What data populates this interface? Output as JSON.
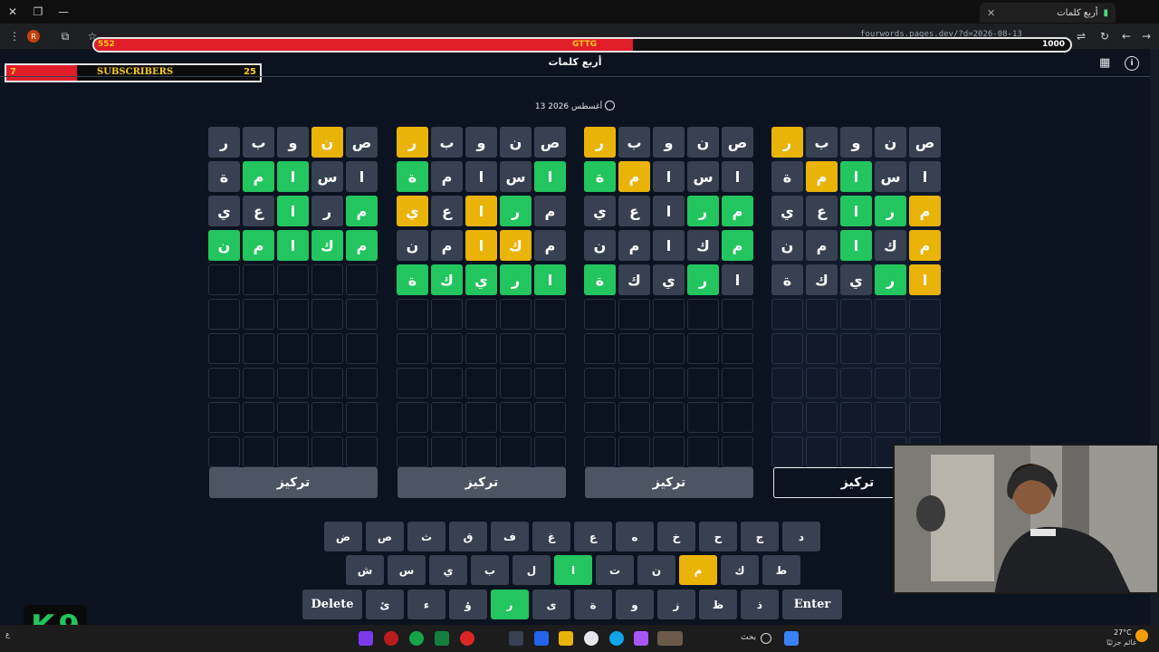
{
  "browser": {
    "tab_title": "أربع كلمات",
    "url": "fourwords.pages.dev/?d=2026-08-13",
    "profile_initial": "R"
  },
  "overlay": {
    "hp_left": "552",
    "hp_center": "GTTG",
    "hp_right": "1000",
    "hp_fill_fraction": 0.552,
    "subs_count_left": "7",
    "subs_label": "SUBSCRIBERS",
    "subs_goal": "25",
    "subs_fill_fraction": 0.28,
    "logo_letters": [
      "K",
      "9"
    ]
  },
  "app": {
    "title": "أربع كلمات",
    "date": "13 أغسطس 2026",
    "focus_label": "تركيز"
  },
  "boards": [
    {
      "id": "board-1",
      "focused": true,
      "rows": [
        [
          [
            "ص",
            "b"
          ],
          [
            "ن",
            "b"
          ],
          [
            "و",
            "b"
          ],
          [
            "ب",
            "b"
          ],
          [
            "ر",
            "y"
          ]
        ],
        [
          [
            "ا",
            "b"
          ],
          [
            "س",
            "b"
          ],
          [
            "ا",
            "g"
          ],
          [
            "م",
            "y"
          ],
          [
            "ة",
            "b"
          ]
        ],
        [
          [
            "م",
            "y"
          ],
          [
            "ر",
            "g"
          ],
          [
            "ا",
            "g"
          ],
          [
            "ع",
            "b"
          ],
          [
            "ي",
            "b"
          ]
        ],
        [
          [
            "م",
            "y"
          ],
          [
            "ك",
            "b"
          ],
          [
            "ا",
            "g"
          ],
          [
            "م",
            "b"
          ],
          [
            "ن",
            "b"
          ]
        ],
        [
          [
            "ا",
            "y"
          ],
          [
            "ر",
            "g"
          ],
          [
            "ي",
            "b"
          ],
          [
            "ك",
            "b"
          ],
          [
            "ة",
            "b"
          ]
        ]
      ]
    },
    {
      "id": "board-2",
      "focused": false,
      "rows": [
        [
          [
            "ص",
            "b"
          ],
          [
            "ن",
            "b"
          ],
          [
            "و",
            "b"
          ],
          [
            "ب",
            "b"
          ],
          [
            "ر",
            "y"
          ]
        ],
        [
          [
            "ا",
            "b"
          ],
          [
            "س",
            "b"
          ],
          [
            "ا",
            "b"
          ],
          [
            "م",
            "y"
          ],
          [
            "ة",
            "g"
          ]
        ],
        [
          [
            "م",
            "g"
          ],
          [
            "ر",
            "g"
          ],
          [
            "ا",
            "b"
          ],
          [
            "ع",
            "b"
          ],
          [
            "ي",
            "b"
          ]
        ],
        [
          [
            "م",
            "g"
          ],
          [
            "ك",
            "b"
          ],
          [
            "ا",
            "b"
          ],
          [
            "م",
            "b"
          ],
          [
            "ن",
            "b"
          ]
        ],
        [
          [
            "ا",
            "b"
          ],
          [
            "ر",
            "g"
          ],
          [
            "ي",
            "b"
          ],
          [
            "ك",
            "b"
          ],
          [
            "ة",
            "g"
          ]
        ]
      ]
    },
    {
      "id": "board-3",
      "focused": false,
      "rows": [
        [
          [
            "ص",
            "b"
          ],
          [
            "ن",
            "b"
          ],
          [
            "و",
            "b"
          ],
          [
            "ب",
            "b"
          ],
          [
            "ر",
            "y"
          ]
        ],
        [
          [
            "ا",
            "g"
          ],
          [
            "س",
            "b"
          ],
          [
            "ا",
            "b"
          ],
          [
            "م",
            "b"
          ],
          [
            "ة",
            "g"
          ]
        ],
        [
          [
            "م",
            "b"
          ],
          [
            "ر",
            "g"
          ],
          [
            "ا",
            "y"
          ],
          [
            "ع",
            "b"
          ],
          [
            "ي",
            "y"
          ]
        ],
        [
          [
            "م",
            "b"
          ],
          [
            "ك",
            "y"
          ],
          [
            "ا",
            "y"
          ],
          [
            "م",
            "b"
          ],
          [
            "ن",
            "b"
          ]
        ],
        [
          [
            "ا",
            "g"
          ],
          [
            "ر",
            "g"
          ],
          [
            "ي",
            "g"
          ],
          [
            "ك",
            "g"
          ],
          [
            "ة",
            "g"
          ]
        ]
      ]
    },
    {
      "id": "board-4",
      "focused": false,
      "rows": [
        [
          [
            "ص",
            "b"
          ],
          [
            "ن",
            "y"
          ],
          [
            "و",
            "b"
          ],
          [
            "ب",
            "b"
          ],
          [
            "ر",
            "b"
          ]
        ],
        [
          [
            "ا",
            "b"
          ],
          [
            "س",
            "b"
          ],
          [
            "ا",
            "g"
          ],
          [
            "م",
            "g"
          ],
          [
            "ة",
            "b"
          ]
        ],
        [
          [
            "م",
            "g"
          ],
          [
            "ر",
            "b"
          ],
          [
            "ا",
            "g"
          ],
          [
            "ع",
            "b"
          ],
          [
            "ي",
            "b"
          ]
        ],
        [
          [
            "م",
            "g"
          ],
          [
            "ك",
            "g"
          ],
          [
            "ا",
            "g"
          ],
          [
            "م",
            "g"
          ],
          [
            "ن",
            "g"
          ]
        ],
        [
          [
            "",
            "e"
          ],
          [
            "",
            "e"
          ],
          [
            "",
            "e"
          ],
          [
            "",
            "e"
          ],
          [
            "",
            "e"
          ]
        ]
      ]
    }
  ],
  "keyboard": {
    "row1": [
      [
        "د",
        "b"
      ],
      [
        "ج",
        "b"
      ],
      [
        "ح",
        "b"
      ],
      [
        "خ",
        "b"
      ],
      [
        "ه",
        "b"
      ],
      [
        "ع",
        "b"
      ],
      [
        "غ",
        "b"
      ],
      [
        "ف",
        "b"
      ],
      [
        "ق",
        "b"
      ],
      [
        "ث",
        "b"
      ],
      [
        "ص",
        "b"
      ],
      [
        "ض",
        "b"
      ]
    ],
    "row2": [
      [
        "ط",
        "b"
      ],
      [
        "ك",
        "b"
      ],
      [
        "م",
        "y"
      ],
      [
        "ن",
        "b"
      ],
      [
        "ت",
        "b"
      ],
      [
        "ا",
        "g"
      ],
      [
        "ل",
        "b"
      ],
      [
        "ب",
        "b"
      ],
      [
        "ي",
        "b"
      ],
      [
        "س",
        "b"
      ],
      [
        "ش",
        "b"
      ]
    ],
    "row3_enter": "Enter",
    "row3": [
      [
        "ذ",
        "b"
      ],
      [
        "ظ",
        "b"
      ],
      [
        "ز",
        "b"
      ],
      [
        "و",
        "b"
      ],
      [
        "ة",
        "b"
      ],
      [
        "ى",
        "b"
      ],
      [
        "ر",
        "g"
      ],
      [
        "ؤ",
        "b"
      ],
      [
        "ء",
        "b"
      ],
      [
        "ئ",
        "b"
      ]
    ],
    "row3_delete": "Delete"
  },
  "taskbar": {
    "search_label": "بحث",
    "weather_temp": "27°C",
    "weather_text": "غائم جزئيًا",
    "lang": "ع"
  },
  "colors": {
    "green": "#22c55e",
    "yellow": "#eab308",
    "gray": "#374151",
    "overlay_red": "#e11d2a"
  }
}
